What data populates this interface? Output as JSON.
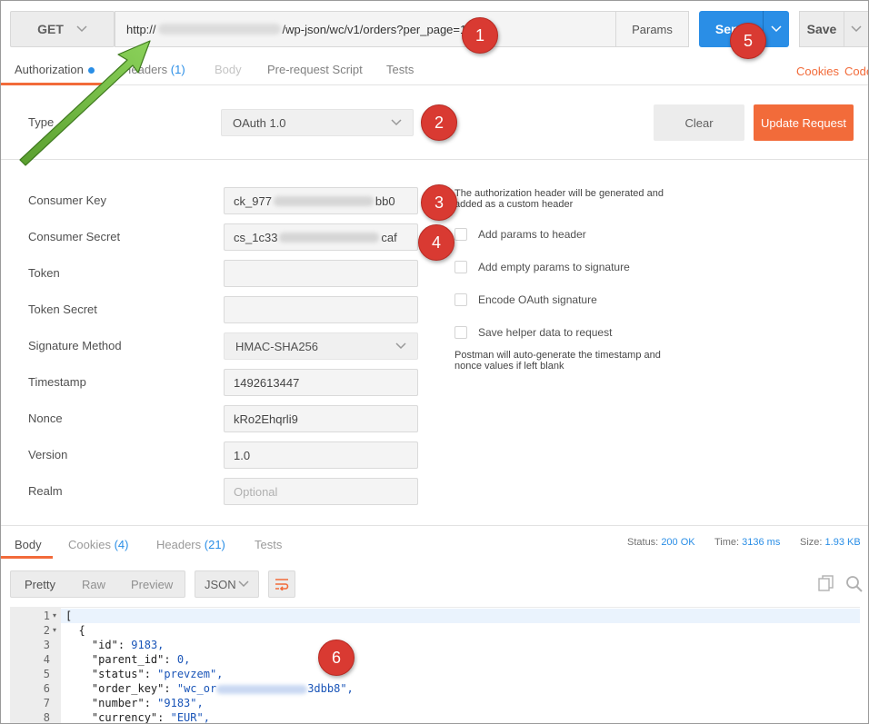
{
  "request": {
    "method": "GET",
    "url_prefix": "http://",
    "url_suffix": "/wp-json/wc/v1/orders?per_page=1",
    "params_label": "Params",
    "send_label": "Send",
    "save_label": "Save"
  },
  "tabs": [
    {
      "label": "Authorization",
      "count": ""
    },
    {
      "label": "Headers",
      "count": "(1)"
    },
    {
      "label": "Body",
      "count": ""
    },
    {
      "label": "Pre-request Script",
      "count": ""
    },
    {
      "label": "Tests",
      "count": ""
    }
  ],
  "links": {
    "cookies": "Cookies",
    "code": "Code"
  },
  "auth": {
    "type_label": "Type",
    "type_value": "OAuth 1.0",
    "clear_label": "Clear",
    "update_label": "Update Request",
    "fields": [
      {
        "label": "Consumer Key",
        "value_start": "ck_977",
        "value_end": "bb0",
        "placeholder": ""
      },
      {
        "label": "Consumer Secret",
        "value_start": "cs_1c33",
        "value_end": "caf",
        "placeholder": ""
      },
      {
        "label": "Token",
        "value_start": "",
        "value_end": "",
        "placeholder": ""
      },
      {
        "label": "Token Secret",
        "value_start": "",
        "value_end": "",
        "placeholder": ""
      },
      {
        "label": "Signature Method",
        "value_start": "HMAC-SHA256",
        "value_end": "",
        "placeholder": ""
      },
      {
        "label": "Timestamp",
        "value_start": "1492613447",
        "value_end": "",
        "placeholder": ""
      },
      {
        "label": "Nonce",
        "value_start": "kRo2Ehqrli9",
        "value_end": "",
        "placeholder": ""
      },
      {
        "label": "Version",
        "value_start": "1.0",
        "value_end": "",
        "placeholder": ""
      },
      {
        "label": "Realm",
        "value_start": "",
        "value_end": "",
        "placeholder": "Optional"
      }
    ],
    "note_top": "The authorization header will be generated and added as a custom header",
    "options": [
      "Add params to header",
      "Add empty params to signature",
      "Encode OAuth signature",
      "Save helper data to request"
    ],
    "note_bottom": "Postman will auto-generate the timestamp and nonce values if left blank"
  },
  "response": {
    "tabs": [
      {
        "label": "Body",
        "count": ""
      },
      {
        "label": "Cookies",
        "count": "(4)"
      },
      {
        "label": "Headers",
        "count": "(21)"
      },
      {
        "label": "Tests",
        "count": ""
      }
    ],
    "status_label": "Status:",
    "status_value": "200 OK",
    "time_label": "Time:",
    "time_value": "3136 ms",
    "size_label": "Size:",
    "size_value": "1.93 KB",
    "formats": [
      "Pretty",
      "Raw",
      "Preview"
    ],
    "language": "JSON",
    "lines": [
      {
        "n": "1",
        "key": "",
        "val": "[",
        "fold": true
      },
      {
        "n": "2",
        "key": "",
        "val": "  {",
        "fold": true
      },
      {
        "n": "3",
        "key": "\"id\"",
        "val": "9183,",
        "fold": false
      },
      {
        "n": "4",
        "key": "\"parent_id\"",
        "val": "0,",
        "fold": false
      },
      {
        "n": "5",
        "key": "\"status\"",
        "val": "\"prevzem\",",
        "fold": false
      },
      {
        "n": "6",
        "key": "\"order_key\"",
        "val": "\"wc_or",
        "val_end": "3dbb8\",",
        "fold": false
      },
      {
        "n": "7",
        "key": "\"number\"",
        "val": "\"9183\",",
        "fold": false
      },
      {
        "n": "8",
        "key": "\"currency\"",
        "val": "\"EUR\",",
        "fold": false
      }
    ]
  },
  "callouts": [
    "1",
    "2",
    "3",
    "4",
    "5",
    "6"
  ],
  "colors": {
    "accent": "#f26b3a",
    "primary": "#2a8ee6",
    "callout": "#d93a32",
    "arrow": "#6db33f"
  }
}
